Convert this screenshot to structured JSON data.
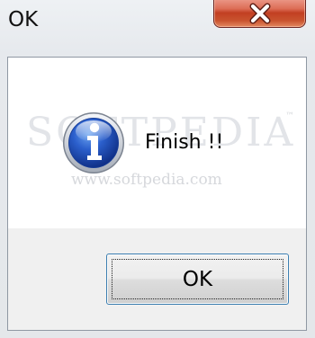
{
  "window": {
    "title": "OK",
    "close_glyph": "✕"
  },
  "dialog": {
    "icon": "information-icon",
    "message": "Finish !!",
    "ok_label": "OK"
  },
  "watermark": {
    "brand": "SOFTPEDIA",
    "trademark": "™",
    "url": "www.softpedia.com"
  },
  "colors": {
    "close_button": "#c9452a",
    "info_icon_blue": "#1f4fb5",
    "focus_border": "#3c7fb1"
  }
}
